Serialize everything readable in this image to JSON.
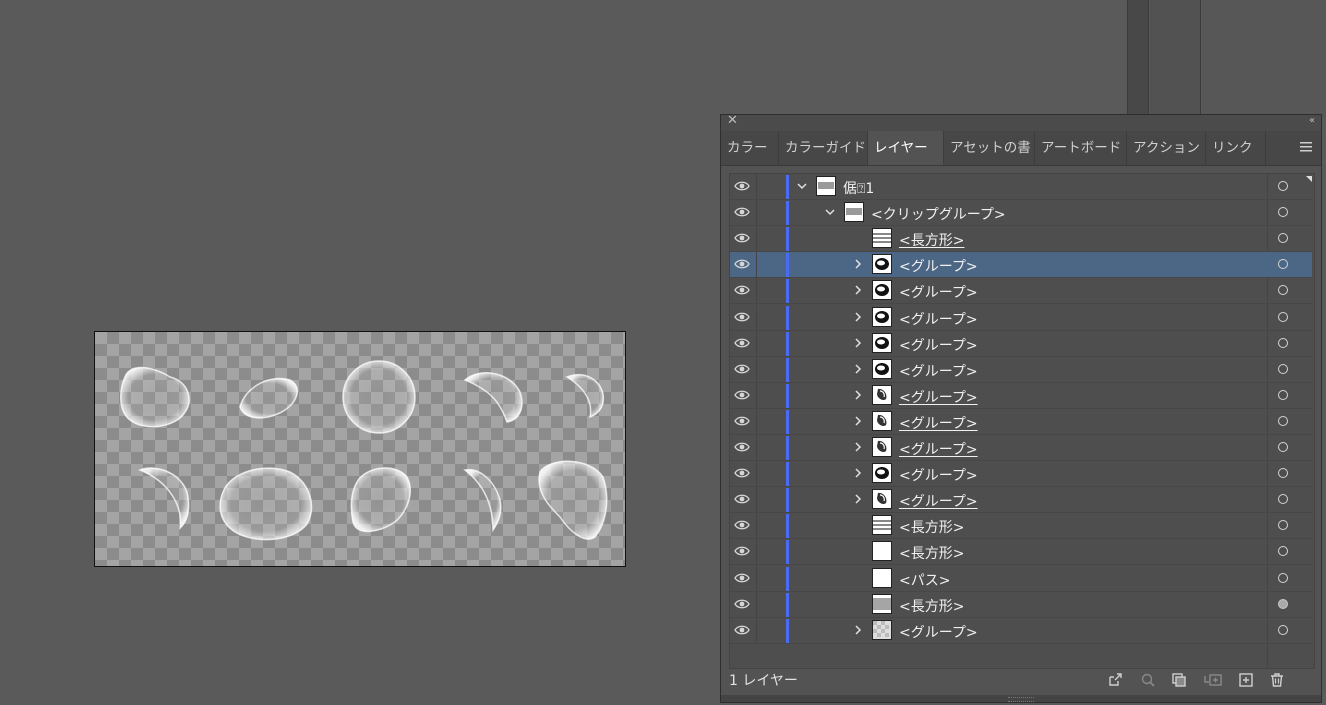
{
  "panel": {
    "tabs": [
      {
        "label": "カラー",
        "active": false
      },
      {
        "label": "カラーガイド",
        "active": false
      },
      {
        "label": "レイヤー",
        "active": true
      },
      {
        "label": "アセットの書",
        "active": false
      },
      {
        "label": "アートボード",
        "active": false
      },
      {
        "label": "アクション",
        "active": false
      },
      {
        "label": "リンク",
        "active": false
      }
    ],
    "footer_label": "1 レイヤー",
    "layers": [
      {
        "name": "倨⍰1",
        "level": 0,
        "expand": "down",
        "thumb": "layer",
        "underline": false,
        "selected": false,
        "target": "open"
      },
      {
        "name": "<クリップグループ>",
        "level": 1,
        "expand": "down",
        "thumb": "layer",
        "underline": false,
        "selected": false,
        "target": "open"
      },
      {
        "name": "<長方形>",
        "level": 2,
        "expand": "none",
        "thumb": "lines",
        "underline": true,
        "selected": false,
        "target": "open"
      },
      {
        "name": "<グループ>",
        "level": 2,
        "expand": "right",
        "thumb": "blob",
        "underline": false,
        "selected": true,
        "target": "open"
      },
      {
        "name": "<グループ>",
        "level": 2,
        "expand": "right",
        "thumb": "blob",
        "underline": false,
        "selected": false,
        "target": "open"
      },
      {
        "name": "<グループ>",
        "level": 2,
        "expand": "right",
        "thumb": "blob",
        "underline": false,
        "selected": false,
        "target": "open"
      },
      {
        "name": "<グループ>",
        "level": 2,
        "expand": "right",
        "thumb": "blob",
        "underline": false,
        "selected": false,
        "target": "open"
      },
      {
        "name": "<グループ>",
        "level": 2,
        "expand": "right",
        "thumb": "blob",
        "underline": false,
        "selected": false,
        "target": "open"
      },
      {
        "name": "<グループ>",
        "level": 2,
        "expand": "right",
        "thumb": "blob-small",
        "underline": true,
        "selected": false,
        "target": "open"
      },
      {
        "name": "<グループ>",
        "level": 2,
        "expand": "right",
        "thumb": "blob-small",
        "underline": true,
        "selected": false,
        "target": "open"
      },
      {
        "name": "<グループ>",
        "level": 2,
        "expand": "right",
        "thumb": "blob-small",
        "underline": true,
        "selected": false,
        "target": "open"
      },
      {
        "name": "<グループ>",
        "level": 2,
        "expand": "right",
        "thumb": "blob",
        "underline": false,
        "selected": false,
        "target": "open"
      },
      {
        "name": "<グループ>",
        "level": 2,
        "expand": "right",
        "thumb": "blob-small",
        "underline": true,
        "selected": false,
        "target": "open"
      },
      {
        "name": "<長方形>",
        "level": 2,
        "expand": "none",
        "thumb": "lines",
        "underline": false,
        "selected": false,
        "target": "open"
      },
      {
        "name": "<長方形>",
        "level": 2,
        "expand": "none",
        "thumb": "white",
        "underline": false,
        "selected": false,
        "target": "open"
      },
      {
        "name": "<パス>",
        "level": 2,
        "expand": "none",
        "thumb": "white",
        "underline": false,
        "selected": false,
        "target": "open"
      },
      {
        "name": "<長方形>",
        "level": 2,
        "expand": "none",
        "thumb": "gray",
        "underline": false,
        "selected": false,
        "target": "filled"
      },
      {
        "name": "<グループ>",
        "level": 2,
        "expand": "right",
        "thumb": "checker",
        "underline": false,
        "selected": false,
        "target": "open"
      }
    ]
  },
  "colors": {
    "canvas_bg": "#5a5a5a",
    "panel_bg": "#535353",
    "selected_row": "#4c6786",
    "layer_color": "#4a6cf5"
  },
  "icons": {
    "footer": [
      "export-icon",
      "locate-object-icon",
      "clipping-mask-icon",
      "new-sublayer-icon",
      "new-layer-icon",
      "trash-icon"
    ]
  }
}
